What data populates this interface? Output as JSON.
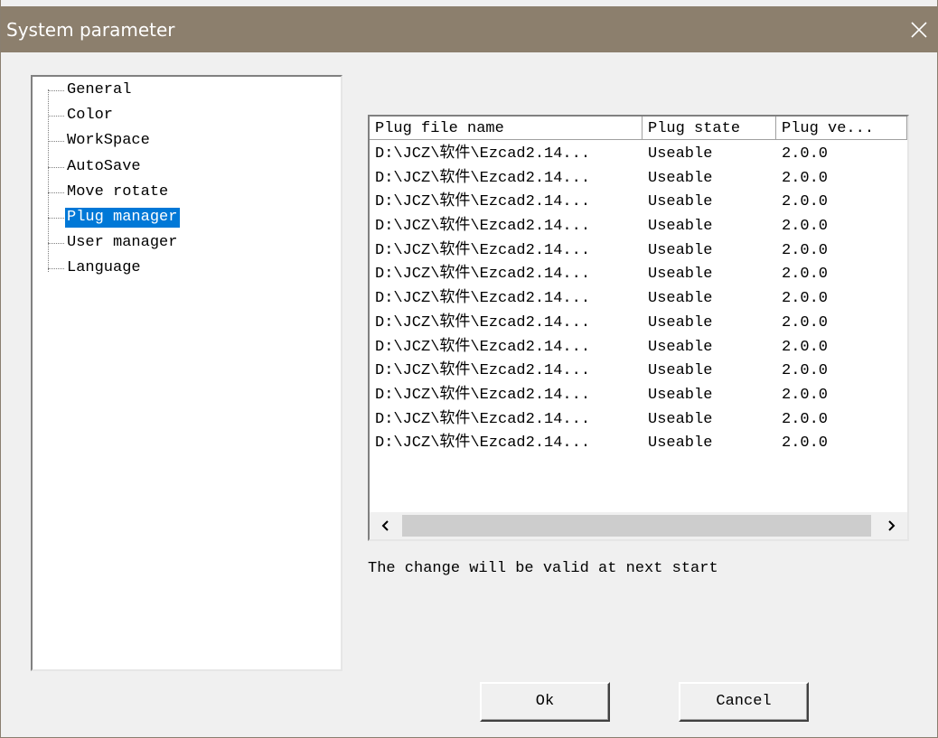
{
  "window": {
    "title": "System parameter",
    "close_icon": "close-icon"
  },
  "tree": {
    "items": [
      {
        "label": "General",
        "selected": false
      },
      {
        "label": "Color",
        "selected": false
      },
      {
        "label": "WorkSpace",
        "selected": false
      },
      {
        "label": "AutoSave",
        "selected": false
      },
      {
        "label": "Move rotate",
        "selected": false
      },
      {
        "label": "Plug manager",
        "selected": true
      },
      {
        "label": "User manager",
        "selected": false
      },
      {
        "label": "Language",
        "selected": false
      }
    ]
  },
  "plug_list": {
    "columns": [
      "Plug file name",
      "Plug state",
      "Plug ve..."
    ],
    "rows": [
      [
        "D:\\JCZ\\软件\\Ezcad2.14...",
        "Useable",
        "2.0.0"
      ],
      [
        "D:\\JCZ\\软件\\Ezcad2.14...",
        "Useable",
        "2.0.0"
      ],
      [
        "D:\\JCZ\\软件\\Ezcad2.14...",
        "Useable",
        "2.0.0"
      ],
      [
        "D:\\JCZ\\软件\\Ezcad2.14...",
        "Useable",
        "2.0.0"
      ],
      [
        "D:\\JCZ\\软件\\Ezcad2.14...",
        "Useable",
        "2.0.0"
      ],
      [
        "D:\\JCZ\\软件\\Ezcad2.14...",
        "Useable",
        "2.0.0"
      ],
      [
        "D:\\JCZ\\软件\\Ezcad2.14...",
        "Useable",
        "2.0.0"
      ],
      [
        "D:\\JCZ\\软件\\Ezcad2.14...",
        "Useable",
        "2.0.0"
      ],
      [
        "D:\\JCZ\\软件\\Ezcad2.14...",
        "Useable",
        "2.0.0"
      ],
      [
        "D:\\JCZ\\软件\\Ezcad2.14...",
        "Useable",
        "2.0.0"
      ],
      [
        "D:\\JCZ\\软件\\Ezcad2.14...",
        "Useable",
        "2.0.0"
      ],
      [
        "D:\\JCZ\\软件\\Ezcad2.14...",
        "Useable",
        "2.0.0"
      ],
      [
        "D:\\JCZ\\软件\\Ezcad2.14...",
        "Useable",
        "2.0.0"
      ]
    ]
  },
  "notice": "The change will be valid at next start",
  "buttons": {
    "ok": "Ok",
    "cancel": "Cancel"
  },
  "colors": {
    "titlebar": "#8c7f6d",
    "selection": "#0078d7",
    "dialog_bg": "#f0f0f0"
  }
}
